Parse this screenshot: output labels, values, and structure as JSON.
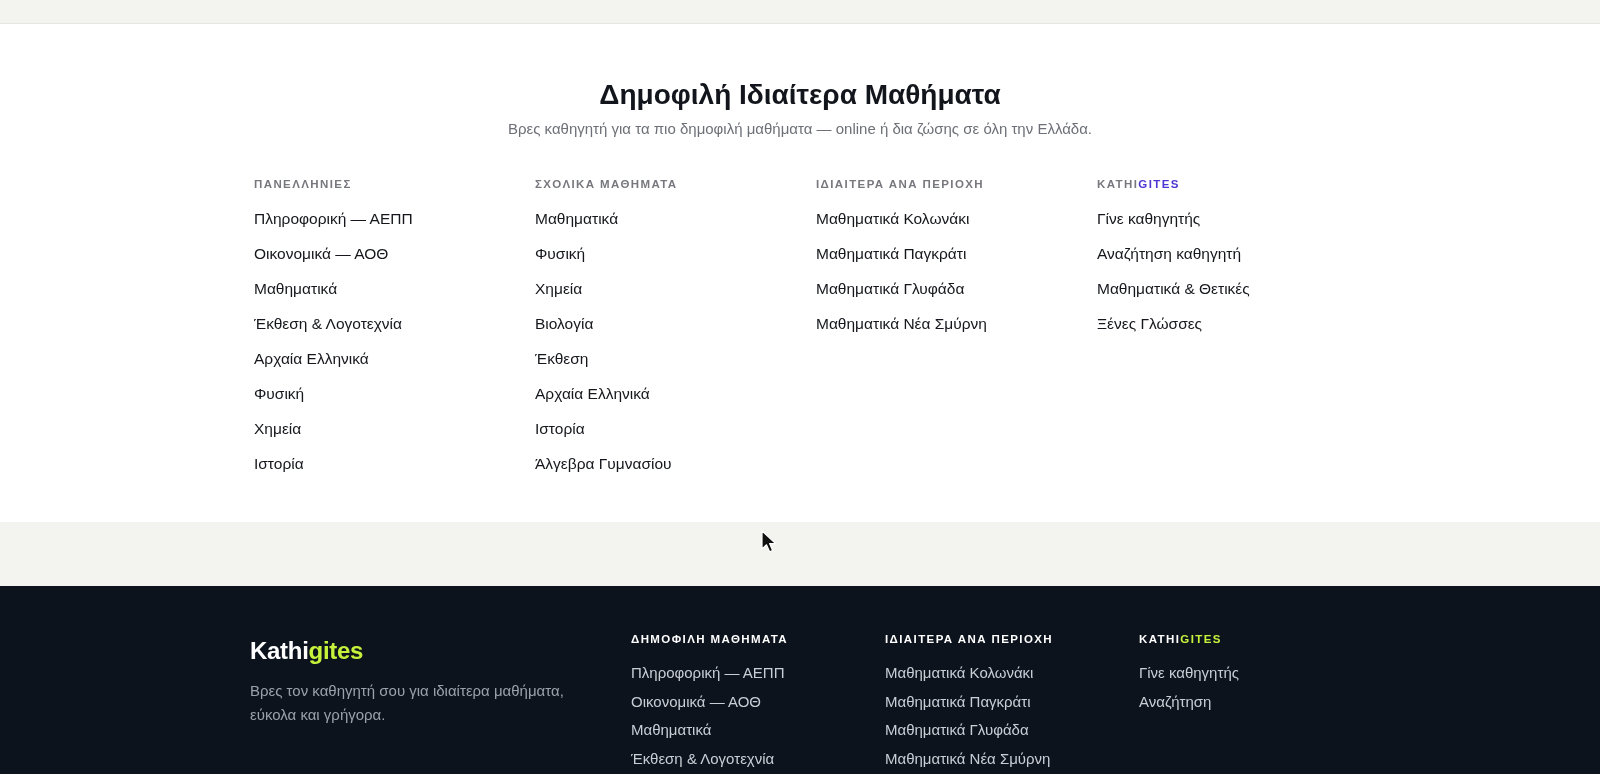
{
  "section": {
    "title": "Δημοφιλή Ιδιαίτερα Μαθήματα",
    "subtitle": "Βρες καθηγητή για τα πιο δημοφιλή μαθήματα — online ή δια ζώσης σε όλη την Ελλάδα.",
    "columns": [
      {
        "heading": "ΠΑΝΕΛΛΗΝΙΕΣ",
        "links": [
          "Πληροφορική — ΑΕΠΠ",
          "Οικονομικά — ΑΟΘ",
          "Μαθηματικά",
          "Έκθεση & Λογοτεχνία",
          "Αρχαία Ελληνικά",
          "Φυσική",
          "Χημεία",
          "Ιστορία"
        ]
      },
      {
        "heading": "ΣΧΟΛΙΚΑ ΜΑΘΗΜΑΤΑ",
        "links": [
          "Μαθηματικά",
          "Φυσική",
          "Χημεία",
          "Βιολογία",
          "Έκθεση",
          "Αρχαία Ελληνικά",
          "Ιστορία",
          "Άλγεβρα Γυμνασίου"
        ]
      },
      {
        "heading": "ΙΔΙΑΙΤΕΡΑ ΑΝΑ ΠΕΡΙΟΧΗ",
        "links": [
          "Μαθηματικά Κολωνάκι",
          "Μαθηματικά Παγκράτι",
          "Μαθηματικά Γλυφάδα",
          "Μαθηματικά Νέα Σμύρνη"
        ]
      },
      {
        "heading": "KATHI",
        "heading_accent": "GITES",
        "links": [
          "Γίνε καθηγητής",
          "Αναζήτηση καθηγητή",
          "Μαθηματικά & Θετικές",
          "Ξένες Γλώσσες"
        ]
      }
    ]
  },
  "footer": {
    "logo": {
      "text": "Kathi",
      "accent": "gites"
    },
    "description": "Βρες τον καθηγητή σου για ιδιαίτερα μαθήματα, εύκολα και γρήγορα.",
    "columns": [
      {
        "heading": "ΔΗΜΟΦΙΛΗ ΜΑΘΗΜΑΤΑ",
        "links": [
          "Πληροφορική — ΑΕΠΠ",
          "Οικονομικά — ΑΟΘ",
          "Μαθηματικά",
          "Έκθεση & Λογοτεχνία"
        ]
      },
      {
        "heading": "ΙΔΙΑΙΤΕΡΑ ΑΝΑ ΠΕΡΙΟΧΗ",
        "links": [
          "Μαθηματικά Κολωνάκι",
          "Μαθηματικά Παγκράτι",
          "Μαθηματικά Γλυφάδα",
          "Μαθηματικά Νέα Σμύρνη"
        ]
      },
      {
        "heading": "KATHI",
        "heading_accent": "GITES",
        "links": [
          "Γίνε καθηγητής",
          "Αναζήτηση"
        ]
      }
    ]
  }
}
